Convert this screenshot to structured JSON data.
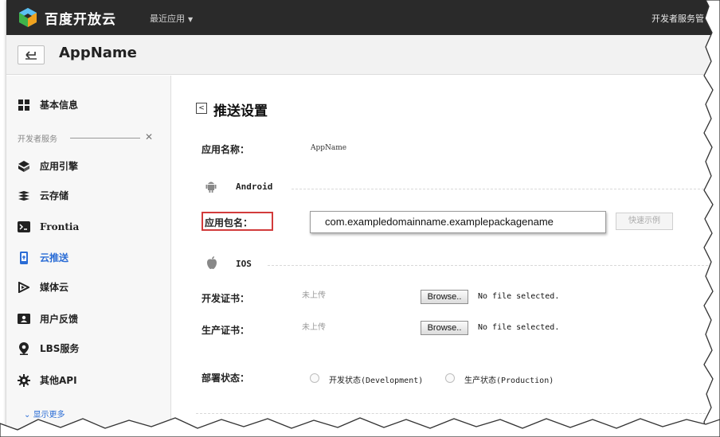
{
  "header": {
    "logo_text": "百度开放云",
    "recent_apps": "最近应用",
    "dev_service": "开发者服务管"
  },
  "appbar": {
    "back_symbol": "⮢",
    "app_name": "AppName"
  },
  "sidebar": {
    "basic_info": "基本信息",
    "group_label": "开发者服务",
    "items": [
      {
        "label": "应用引擎",
        "icon": "app-engine-icon"
      },
      {
        "label": "云存储",
        "icon": "cloud-storage-icon"
      },
      {
        "label": "Frontia",
        "icon": "frontia-icon"
      },
      {
        "label": "云推送",
        "icon": "cloud-push-icon",
        "active": true
      },
      {
        "label": "媒体云",
        "icon": "media-cloud-icon"
      },
      {
        "label": "用户反馈",
        "icon": "user-feedback-icon"
      },
      {
        "label": "LBS服务",
        "icon": "location-pin-icon"
      },
      {
        "label": "其他API",
        "icon": "gear-icon"
      }
    ],
    "show_more": "显示更多"
  },
  "main": {
    "title_back": "<",
    "title": "推送设置",
    "app_name_label": "应用名称：",
    "app_name_value": "AppName",
    "android_label": "Android",
    "package_label": "应用包名：",
    "package_value": "com.exampledomainname.examplepackagename",
    "quick_example": "快速示例",
    "ios_label": "IOS",
    "dev_cert_label": "开发证书：",
    "dev_cert_status": "未上传",
    "prod_cert_label": "生产证书：",
    "prod_cert_status": "未上传",
    "browse": "Browse..",
    "no_file": "No file selected.",
    "deploy_label": "部署状态：",
    "dev_mode": "开发状态(Development)",
    "prod_mode": "生产状态(Production)"
  },
  "colors": {
    "topbar": "#2a2a2a",
    "accent_blue": "#2a6cd5",
    "highlight_red": "#d23b3b"
  }
}
